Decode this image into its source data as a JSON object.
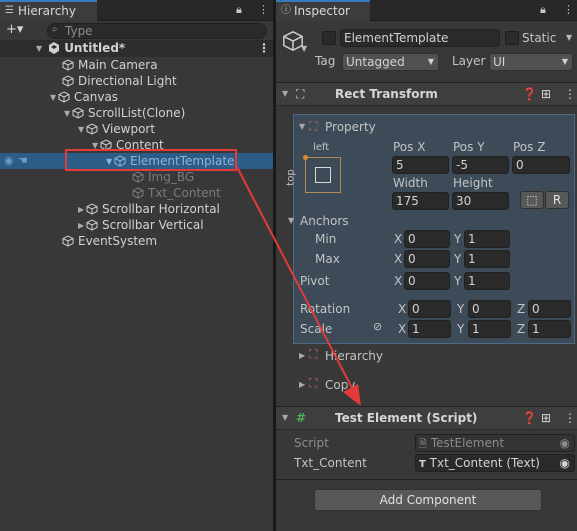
{
  "hierarchy": {
    "tab_label": "Hierarchy",
    "search_placeholder": "Type",
    "add_label": "+▾",
    "items": [
      {
        "label": "Untitled*"
      },
      {
        "label": "Main Camera"
      },
      {
        "label": "Directional Light"
      },
      {
        "label": "Canvas"
      },
      {
        "label": "ScrollList(Clone)"
      },
      {
        "label": "Viewport"
      },
      {
        "label": "Content"
      },
      {
        "label": "ElementTemplate"
      },
      {
        "label": "Img_BG"
      },
      {
        "label": "Txt_Content"
      },
      {
        "label": "Scrollbar Horizontal"
      },
      {
        "label": "Scrollbar Vertical"
      },
      {
        "label": "EventSystem"
      }
    ]
  },
  "inspector": {
    "tab_label": "Inspector",
    "object_name": "ElementTemplate",
    "static_label": "Static",
    "tag_label": "Tag",
    "tag_value": "Untagged",
    "layer_label": "Layer",
    "layer_value": "UI",
    "rect_transform": {
      "title": "Rect Transform",
      "property_label": "Property",
      "anchor_h": "left",
      "anchor_v": "top",
      "pos_x_label": "Pos X",
      "pos_x": "5",
      "pos_y_label": "Pos Y",
      "pos_y": "-5",
      "pos_z_label": "Pos Z",
      "pos_z": "0",
      "width_label": "Width",
      "width": "175",
      "height_label": "Height",
      "height": "30",
      "r_label": "R",
      "anchors_label": "Anchors",
      "min_label": "Min",
      "min_x": "0",
      "min_y": "1",
      "max_label": "Max",
      "max_x": "0",
      "max_y": "1",
      "pivot_label": "Pivot",
      "pivot_x": "0",
      "pivot_y": "1",
      "rotation_label": "Rotation",
      "rot_x": "0",
      "rot_y": "0",
      "rot_z": "0",
      "scale_label": "Scale",
      "scale_x": "1",
      "scale_y": "1",
      "scale_z": "1",
      "x": "X",
      "y": "Y",
      "z": "Z"
    },
    "hierarchy_sub": "Hierarchy",
    "copy_sub": "Copy",
    "script_component": {
      "title": "Test Element (Script)",
      "script_label": "Script",
      "script_value": "TestElement",
      "txt_label": "Txt_Content",
      "txt_value": "Txt_Content (Text)"
    },
    "add_component": "Add Component"
  },
  "colors": {
    "accent": "#3a79bb",
    "selection": "#2c5d87",
    "highlight": "#e33b3b"
  }
}
